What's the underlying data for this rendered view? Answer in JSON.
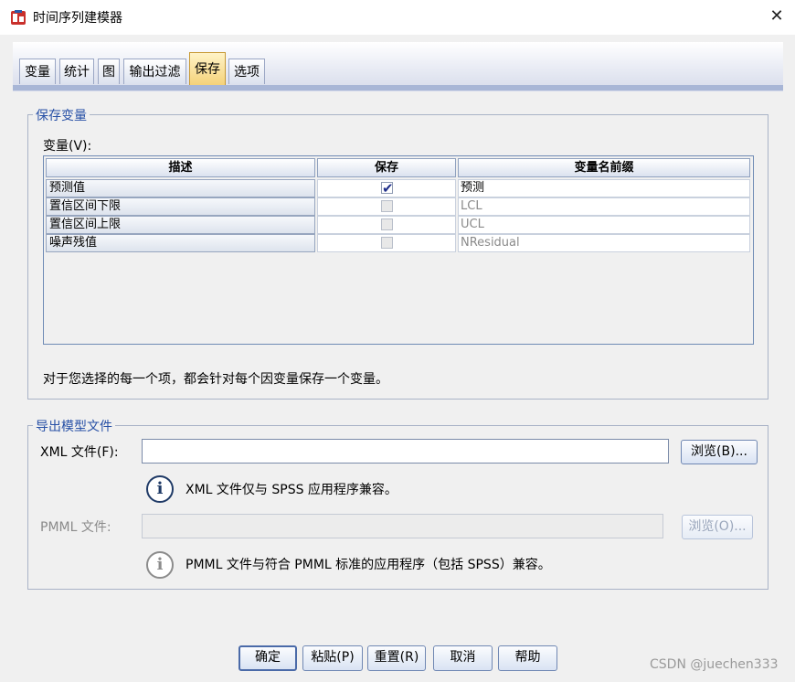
{
  "window": {
    "title": "时间序列建模器",
    "icon": "spss-app-icon",
    "close_glyph": "✕"
  },
  "tabs": [
    {
      "label": "变量",
      "active": false
    },
    {
      "label": "统计",
      "active": false
    },
    {
      "label": "图",
      "active": false
    },
    {
      "label": "输出过滤",
      "active": false
    },
    {
      "label": "保存",
      "active": true
    },
    {
      "label": "选项",
      "active": false
    }
  ],
  "save_vars": {
    "group_title": "保存变量",
    "vars_label": "变量(V):",
    "columns": [
      "描述",
      "保存",
      "变量名前缀"
    ],
    "rows": [
      {
        "desc": "预测值",
        "save": true,
        "prefix": "预测"
      },
      {
        "desc": "置信区间下限",
        "save": false,
        "prefix": "LCL"
      },
      {
        "desc": "置信区间上限",
        "save": false,
        "prefix": "UCL"
      },
      {
        "desc": "噪声残值",
        "save": false,
        "prefix": "NResidual"
      }
    ],
    "note": "对于您选择的每一个项，都会针对每个因变量保存一个变量。"
  },
  "export": {
    "group_title": "导出模型文件",
    "xml_label": "XML 文件(F):",
    "xml_value": "",
    "browse_xml": "浏览(B)...",
    "xml_note": "XML 文件仅与 SPSS 应用程序兼容。",
    "pmml_label": "PMML 文件:",
    "pmml_value": "",
    "browse_pmml": "浏览(O)...",
    "pmml_note": "PMML 文件与符合 PMML 标准的应用程序（包括 SPSS）兼容。",
    "info_glyph": "i"
  },
  "buttons": {
    "ok": "确定",
    "paste": "粘贴(P)",
    "reset": "重置(R)",
    "cancel": "取消",
    "help": "帮助"
  },
  "watermark": "CSDN @juechen333",
  "check_glyph": "✔"
}
